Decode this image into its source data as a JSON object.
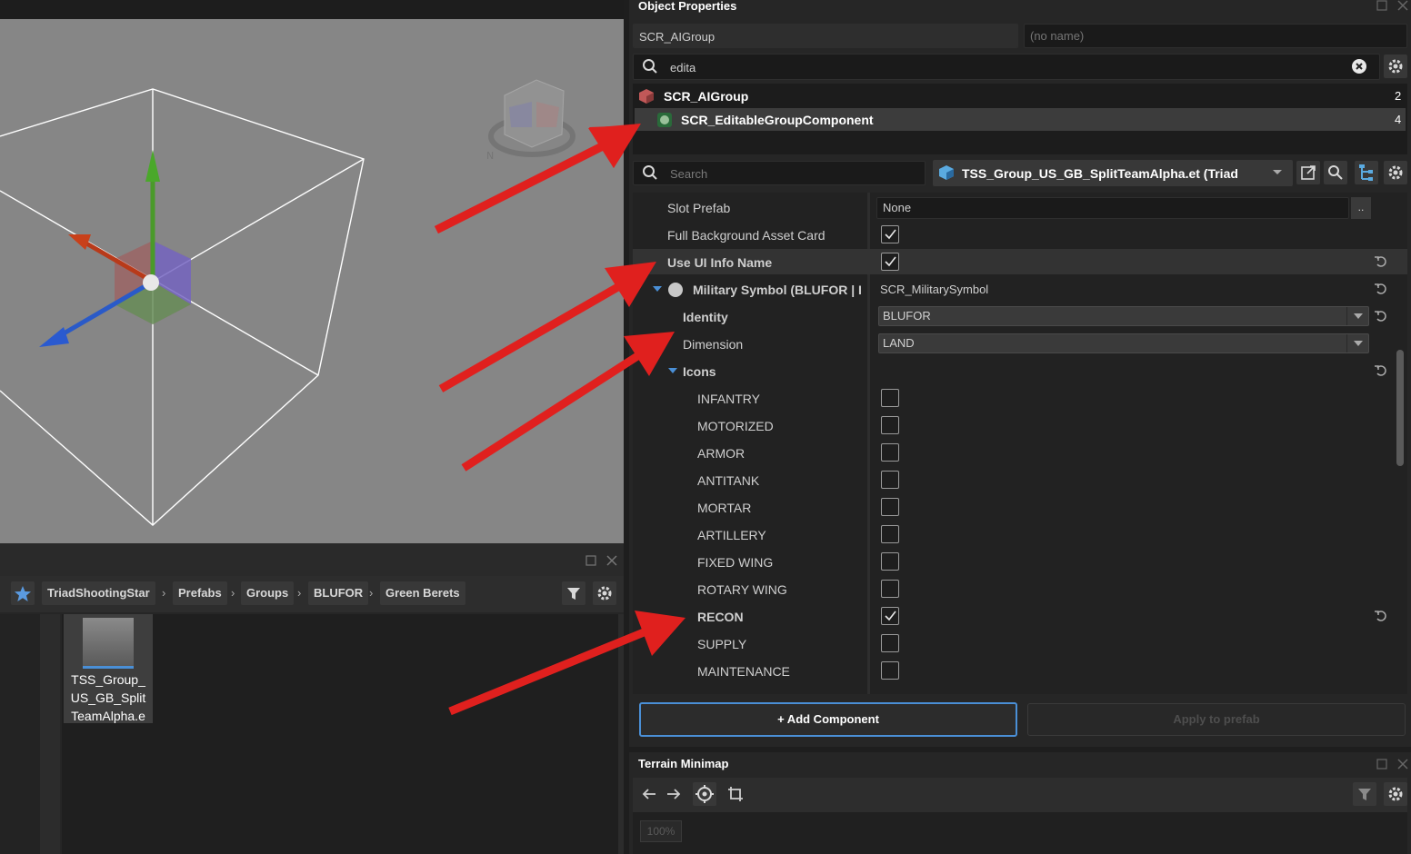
{
  "properties_panel": {
    "title": "Object Properties",
    "entity_class": "SCR_AIGroup",
    "entity_name_placeholder": "(no name)",
    "filter_value": "edita",
    "hierarchy": [
      {
        "label": "SCR_AIGroup",
        "count": "2"
      },
      {
        "label": "SCR_EditableGroupComponent",
        "count": "4"
      }
    ],
    "search_placeholder": "Search",
    "prefab_name": "TSS_Group_US_GB_SplitTeamAlpha.et (Triad",
    "rows": {
      "slot_prefab": {
        "label": "Slot Prefab",
        "value": "None",
        "browse": ".."
      },
      "full_bg": {
        "label": "Full Background Asset Card"
      },
      "use_ui_info": {
        "label": "Use UI Info Name"
      },
      "military_symbol": {
        "label": "Military Symbol (BLUFOR | I",
        "value": "SCR_MilitarySymbol"
      },
      "identity": {
        "label": "Identity",
        "value": "BLUFOR"
      },
      "dimension": {
        "label": "Dimension",
        "value": "LAND"
      },
      "icons": {
        "label": "Icons"
      }
    },
    "icons": [
      {
        "label": "INFANTRY",
        "checked": false
      },
      {
        "label": "MOTORIZED",
        "checked": false
      },
      {
        "label": "ARMOR",
        "checked": false
      },
      {
        "label": "ANTITANK",
        "checked": false
      },
      {
        "label": "MORTAR",
        "checked": false
      },
      {
        "label": "ARTILLERY",
        "checked": false
      },
      {
        "label": "FIXED WING",
        "checked": false
      },
      {
        "label": "ROTARY WING",
        "checked": false
      },
      {
        "label": "RECON",
        "checked": true
      },
      {
        "label": "SUPPLY",
        "checked": false
      },
      {
        "label": "MAINTENANCE",
        "checked": false
      }
    ],
    "add_component_label": "+ Add Component",
    "apply_prefab_label": "Apply to prefab"
  },
  "browser": {
    "breadcrumbs": [
      "TriadShootingStar",
      "Prefabs",
      "Groups",
      "BLUFOR",
      "Green Berets"
    ],
    "file_label_lines": [
      "TSS_Group_",
      "US_GB_Split",
      "TeamAlpha.e"
    ]
  },
  "minimap": {
    "title": "Terrain Minimap",
    "zoom": "100%"
  },
  "colors": {
    "accent_blue": "#4a8fd6",
    "annotation_red": "#e0201e"
  }
}
